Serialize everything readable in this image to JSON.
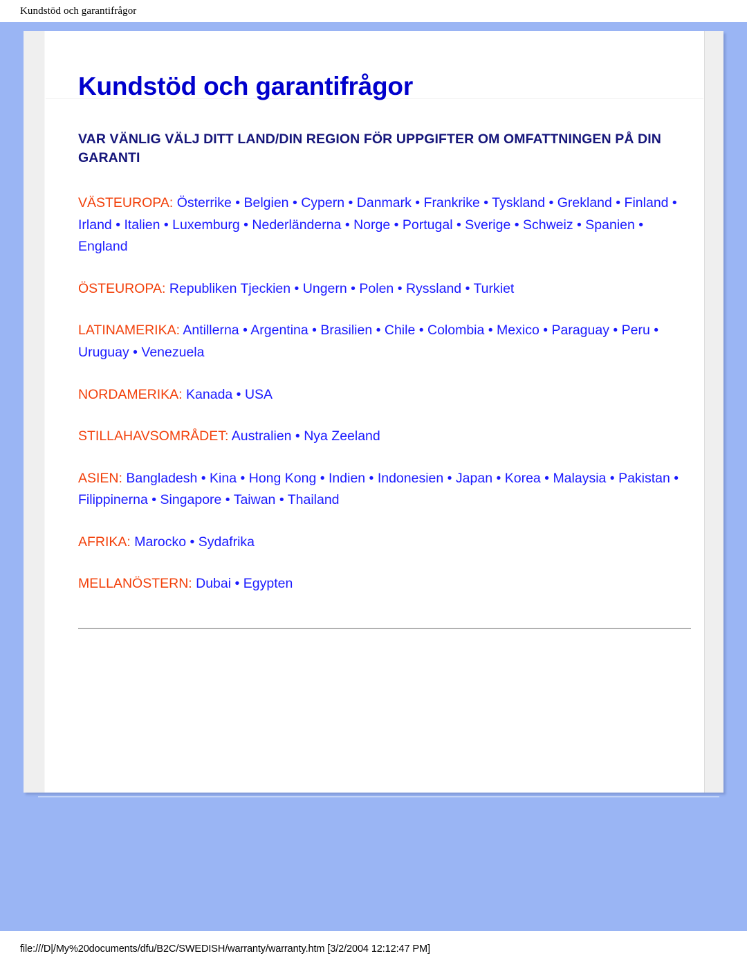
{
  "header": {
    "running_title": "Kundstöd och garantifrågor"
  },
  "document": {
    "title": "Kundstöd och garantifrågor",
    "subtitle": "VAR VÄNLIG VÄLJ DITT LAND/DIN REGION FÖR UPPGIFTER OM OMFATTNINGEN PÅ DIN GARANTI",
    "separator": " • ",
    "regions": [
      {
        "label": "VÄSTEUROPA:",
        "countries": [
          "Österrike",
          "Belgien",
          "Cypern",
          "Danmark",
          "Frankrike",
          "Tyskland",
          "Grekland",
          "Finland",
          "Irland",
          "Italien",
          "Luxemburg",
          "Nederländerna",
          "Norge",
          "Portugal",
          "Sverige",
          "Schweiz",
          "Spanien",
          "England"
        ]
      },
      {
        "label": "ÖSTEUROPA:",
        "countries": [
          "Republiken Tjeckien",
          "Ungern",
          "Polen",
          "Ryssland",
          "Turkiet"
        ]
      },
      {
        "label": "LATINAMERIKA:",
        "countries": [
          "Antillerna",
          "Argentina",
          "Brasilien",
          "Chile",
          "Colombia",
          "Mexico",
          "Paraguay",
          "Peru",
          "Uruguay",
          "Venezuela"
        ]
      },
      {
        "label": "NORDAMERIKA:",
        "countries": [
          "Kanada",
          "USA"
        ]
      },
      {
        "label": "STILLAHAVSOMRÅDET:",
        "countries": [
          "Australien",
          "Nya Zeeland"
        ]
      },
      {
        "label": "ASIEN:",
        "countries": [
          "Bangladesh",
          "Kina",
          "Hong Kong",
          "Indien",
          "Indonesien",
          "Japan",
          "Korea",
          "Malaysia",
          "Pakistan",
          "Filippinerna",
          "Singapore",
          "Taiwan",
          "Thailand"
        ]
      },
      {
        "label": "AFRIKA:",
        "countries": [
          "Marocko",
          "Sydafrika"
        ]
      },
      {
        "label": "MELLANÖSTERN:",
        "countries": [
          "Dubai",
          "Egypten"
        ]
      }
    ]
  },
  "footer": {
    "path_text": "file:///D|/My%20documents/dfu/B2C/SWEDISH/warranty/warranty.htm [3/2/2004 12:12:47 PM]"
  },
  "colors": {
    "page_background": "#9ab5f4",
    "card_background": "#ffffff",
    "gutter": "#efefef",
    "title": "#0000cc",
    "subtitle": "#15157a",
    "region_label": "#f2400a",
    "link": "#1a1aff"
  }
}
